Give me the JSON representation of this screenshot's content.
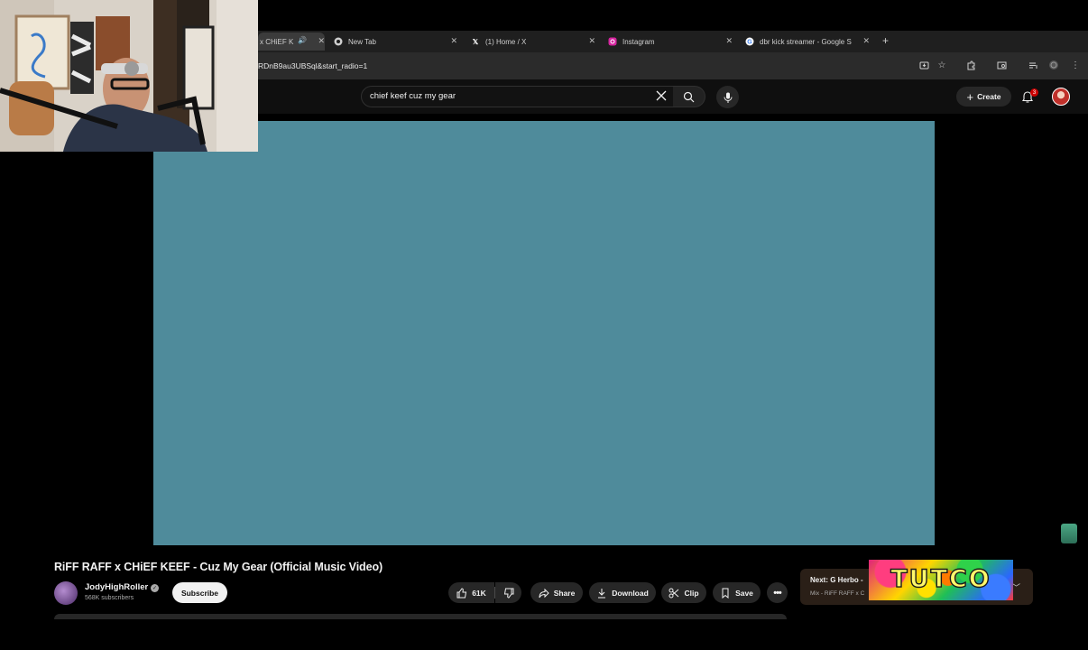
{
  "browser": {
    "tabs": [
      {
        "title": "x CHiEF K",
        "active": true,
        "icon": "audio-icon"
      },
      {
        "title": "New Tab",
        "active": false,
        "icon": "chrome-icon"
      },
      {
        "title": "(1) Home / X",
        "active": false,
        "icon": "x-logo-icon"
      },
      {
        "title": "Instagram",
        "active": false,
        "icon": "instagram-icon"
      },
      {
        "title": "dbr kick streamer - Google S",
        "active": false,
        "icon": "google-icon"
      }
    ],
    "url": "RDnB9au3UBSql&start_radio=1"
  },
  "youtube": {
    "search_query": "chief keef cuz my gear",
    "create_label": "Create",
    "notification_count": "3"
  },
  "video": {
    "title": "RiFF RAFF x CHiEF KEEF - Cuz My Gear (Official Music Video)",
    "channel": "JodyHighRoller",
    "subscribers": "568K subscribers",
    "subscribe_label": "Subscribe",
    "likes": "61K",
    "share_label": "Share",
    "download_label": "Download",
    "clip_label": "Clip",
    "save_label": "Save",
    "player_color": "#4f8b9b"
  },
  "next_up": {
    "title": "Next: G Herbo -",
    "subtitle": "Mix - RiFF RAFF x C",
    "banner_text": "TUTCO"
  }
}
